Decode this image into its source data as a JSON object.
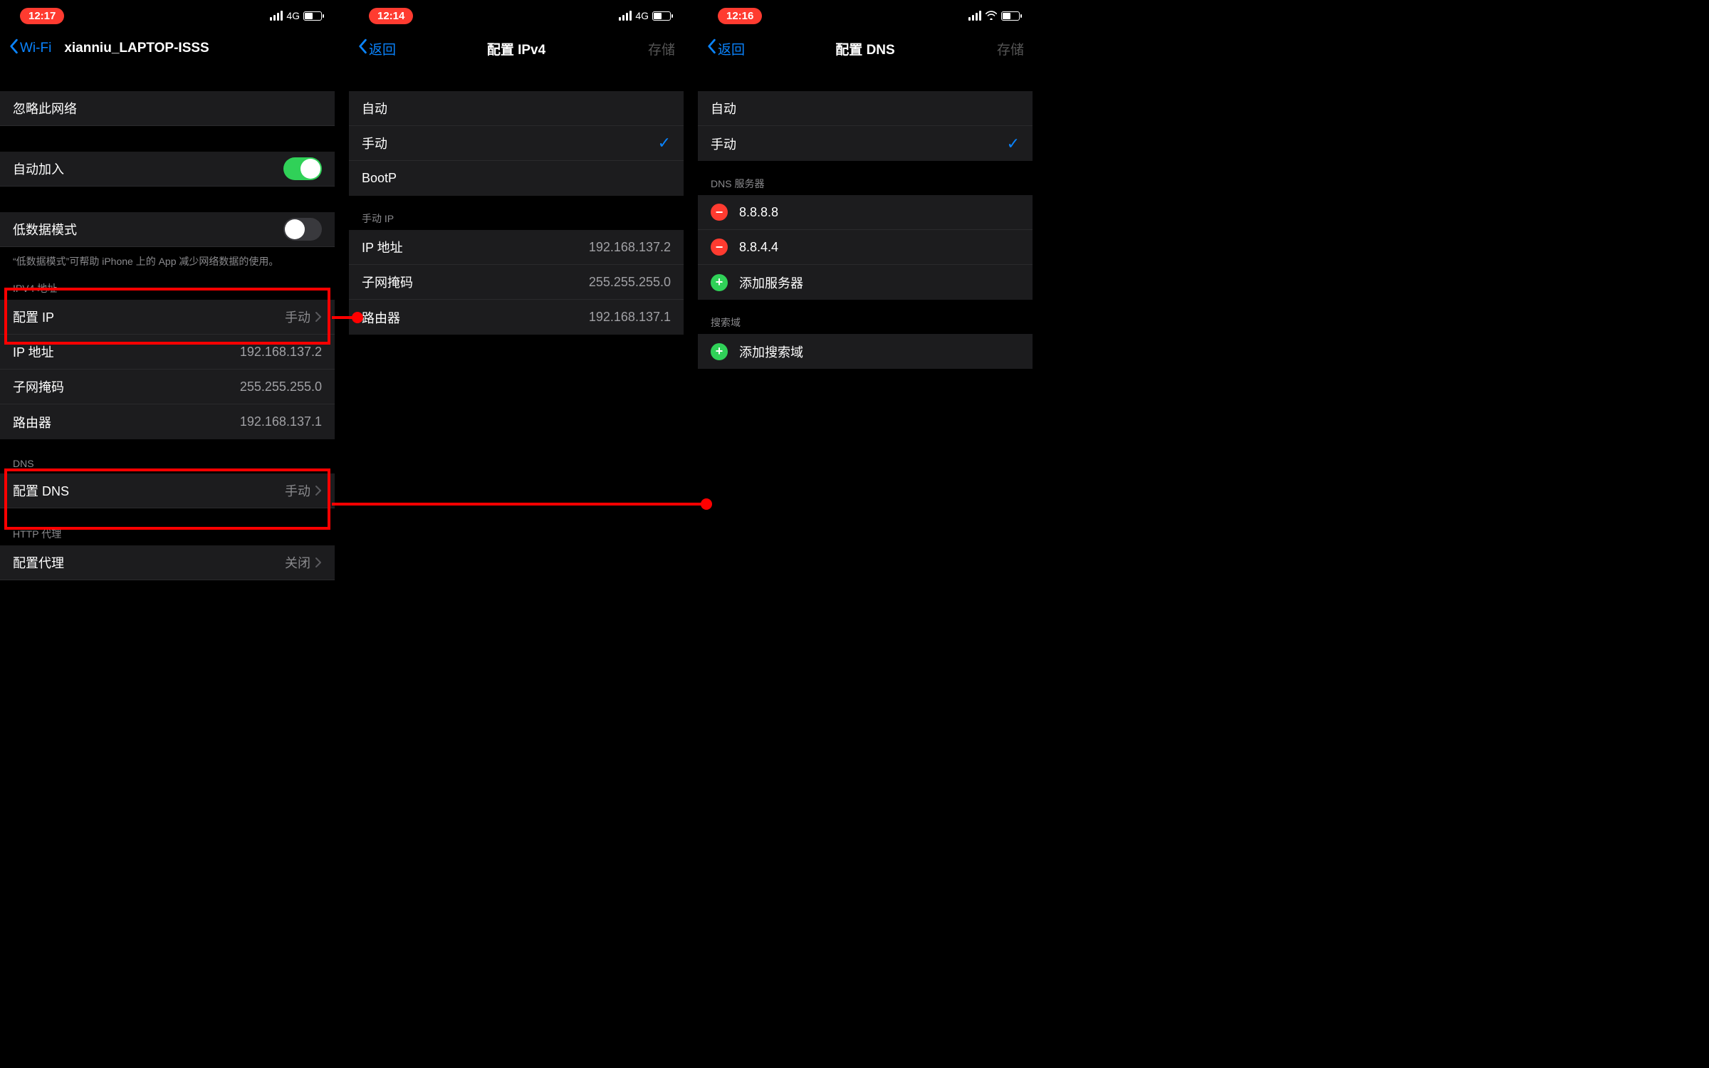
{
  "screen1": {
    "time": "12:17",
    "net": "4G",
    "back": "Wi-Fi",
    "title": "xianniu_LAPTOP-ISSS",
    "forget": "忽略此网络",
    "auto_join": "自动加入",
    "low_data": "低数据模式",
    "low_data_note": "“低数据模式”可帮助 iPhone 上的 App 减少网络数据的使用。",
    "ipv4_header": "IPV4 地址",
    "config_ip": "配置 IP",
    "config_ip_val": "手动",
    "ip_label": "IP 地址",
    "ip_val": "192.168.137.2",
    "mask_label": "子网掩码",
    "mask_val": "255.255.255.0",
    "router_label": "路由器",
    "router_val": "192.168.137.1",
    "dns_header": "DNS",
    "config_dns": "配置 DNS",
    "config_dns_val": "手动",
    "proxy_header": "HTTP 代理",
    "config_proxy": "配置代理",
    "config_proxy_val": "关闭"
  },
  "screen2": {
    "time": "12:14",
    "net": "4G",
    "back": "返回",
    "title": "配置 IPv4",
    "save": "存储",
    "opt_auto": "自动",
    "opt_manual": "手动",
    "opt_bootp": "BootP",
    "manual_header": "手动 IP",
    "ip_label": "IP 地址",
    "ip_val": "192.168.137.2",
    "mask_label": "子网掩码",
    "mask_val": "255.255.255.0",
    "router_label": "路由器",
    "router_val": "192.168.137.1"
  },
  "screen3": {
    "time": "12:16",
    "back": "返回",
    "title": "配置 DNS",
    "save": "存储",
    "opt_auto": "自动",
    "opt_manual": "手动",
    "dns_header": "DNS 服务器",
    "dns1": "8.8.8.8",
    "dns2": "8.8.4.4",
    "add_server": "添加服务器",
    "search_header": "搜索域",
    "add_search": "添加搜索域"
  }
}
